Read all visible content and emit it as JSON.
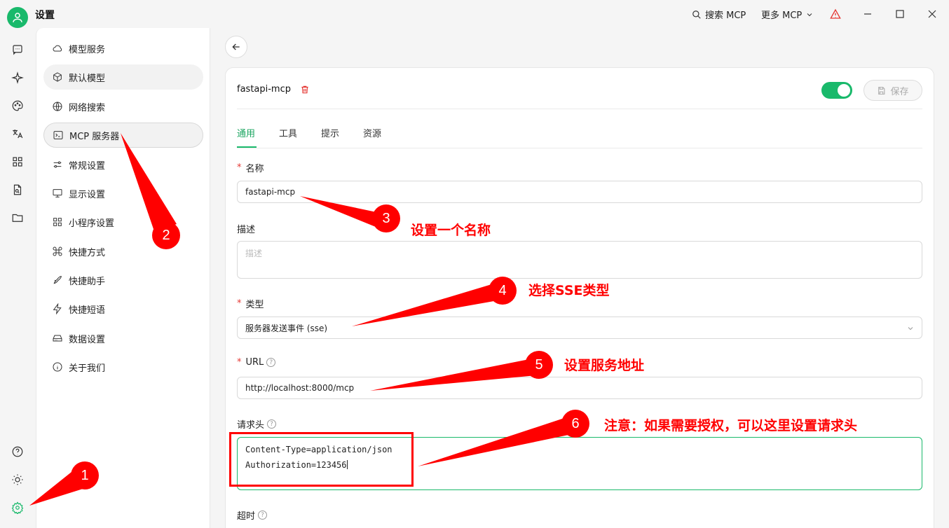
{
  "window": {
    "title": "设置",
    "search_mcp": "搜索 MCP",
    "more_mcp": "更多 MCP"
  },
  "nav": {
    "items": [
      {
        "label": "模型服务",
        "icon": "cloud-icon"
      },
      {
        "label": "默认模型",
        "icon": "cube-icon"
      },
      {
        "label": "网络搜索",
        "icon": "globe-icon"
      },
      {
        "label": "MCP 服务器",
        "icon": "terminal-icon"
      },
      {
        "label": "常规设置",
        "icon": "sliders-icon"
      },
      {
        "label": "显示设置",
        "icon": "monitor-icon"
      },
      {
        "label": "小程序设置",
        "icon": "grid-icon"
      },
      {
        "label": "快捷方式",
        "icon": "command-icon"
      },
      {
        "label": "快捷助手",
        "icon": "rocket-icon"
      },
      {
        "label": "快捷短语",
        "icon": "zap-icon"
      },
      {
        "label": "数据设置",
        "icon": "drive-icon"
      },
      {
        "label": "关于我们",
        "icon": "info-icon"
      }
    ]
  },
  "server": {
    "name": "fastapi-mcp",
    "save_label": "保存",
    "enabled": true
  },
  "tabs": [
    "通用",
    "工具",
    "提示",
    "资源"
  ],
  "form": {
    "name_label": "名称",
    "name_value": "fastapi-mcp",
    "desc_label": "描述",
    "desc_placeholder": "描述",
    "type_label": "类型",
    "type_value": "服务器发送事件 (sse)",
    "url_label": "URL",
    "url_value": "http://localhost:8000/mcp",
    "headers_label": "请求头",
    "headers_line1": "Content-Type=application/json",
    "headers_line2": "Authorization=123456",
    "timeout_label": "超时"
  },
  "annotations": {
    "badges": [
      "1",
      "2",
      "3",
      "4",
      "5",
      "6"
    ],
    "note3": "设置一个名称",
    "note4": "选择SSE类型",
    "note5": "设置服务地址",
    "note6": "注意：如果需要授权，可以这里设置请求头"
  },
  "colors": {
    "accent": "#19b96b",
    "annotation": "#ff0000",
    "required": "#e53935"
  }
}
